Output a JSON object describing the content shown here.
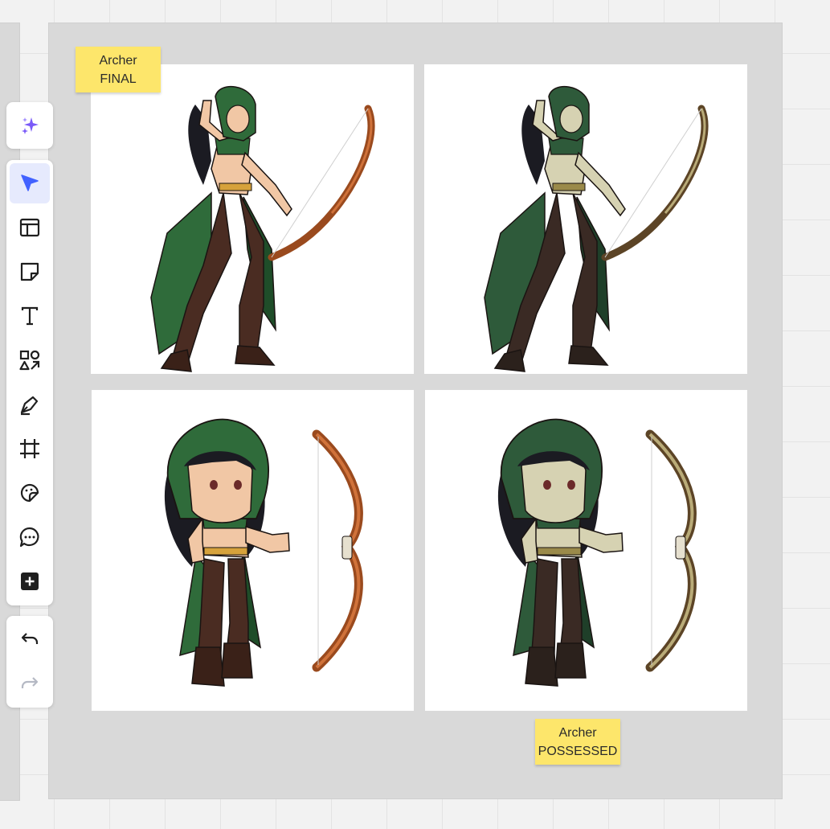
{
  "board": {
    "stickies": [
      {
        "line1": "Archer",
        "line2": "FINAL"
      },
      {
        "line1": "Archer",
        "line2": "POSSESSED"
      }
    ],
    "panels": [
      {
        "name": "archer-final-full-art",
        "palette": "normal"
      },
      {
        "name": "archer-possessed-full-art",
        "palette": "possessed"
      },
      {
        "name": "archer-final-chibi-art",
        "palette": "normal"
      },
      {
        "name": "archer-possessed-chibi-art",
        "palette": "possessed"
      }
    ]
  },
  "palettes": {
    "normal": {
      "skin": "#f1c7a5",
      "cloak": "#2f6b3a",
      "cloak_dark": "#1f4d29",
      "pants": "#4a2c22",
      "boots": "#3a2118",
      "hair": "#1b1b22",
      "bow": "#9a4a1e",
      "bow_light": "#d0723a",
      "gold": "#d6a23b"
    },
    "possessed": {
      "skin": "#d6d2b2",
      "cloak": "#2e5a3a",
      "cloak_dark": "#1f3f29",
      "pants": "#3a2a24",
      "boots": "#2b211c",
      "hair": "#1b1b22",
      "bow": "#5c4426",
      "bow_light": "#b9ab78",
      "gold": "#9a8a4a"
    }
  },
  "toolbar": {
    "ai_tool": "sparkle-icon",
    "tools": [
      "select-cursor-icon",
      "layout-template-icon",
      "sticky-note-icon",
      "text-icon",
      "shapes-icon",
      "pen-icon",
      "frame-icon",
      "sticker-icon",
      "comment-icon",
      "add-more-icon"
    ],
    "history": [
      "undo-icon",
      "redo-icon"
    ],
    "accent": "#4262ff"
  }
}
